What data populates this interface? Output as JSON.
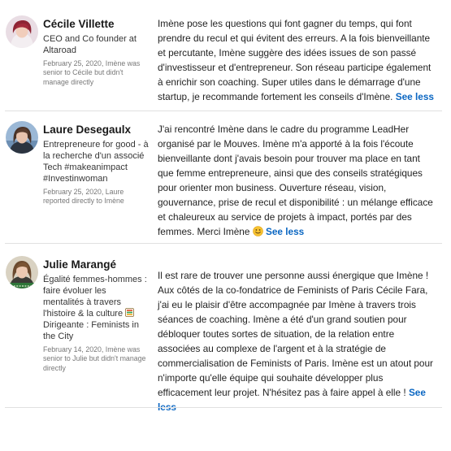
{
  "recommendations": [
    {
      "name": "Cécile Villette",
      "headline": "CEO and Co founder at Altaroad",
      "meta": "February 25, 2020, Imène was senior to Cécile but didn't manage directly",
      "text": "Imène pose les questions qui font gagner du temps, qui font prendre du recul et qui évitent des erreurs. A la fois bienveillante et percutante, Imène suggère des idées issues de son passé d'investisseur et d'entrepreneur. Son réseau participe également à enrichir son coaching. Super utiles dans le démarrage d'une startup, je recommande fortement les conseils d'Imène.",
      "see_less": "See less"
    },
    {
      "name": "Laure Desegaulx",
      "headline": "Entrepreneure for good - à la recherche d'un associé Tech #makeanimpact #Investinwoman",
      "meta": "February 25, 2020, Laure reported directly to Imène",
      "text": "J'ai rencontré Imène dans le cadre du programme LeadHer organisé par le Mouves. Imène m'a apporté à la fois l'écoute bienveillante dont j'avais besoin pour trouver ma place en tant que femme entrepreneure, ainsi que des conseils stratégiques pour orienter mon business. Ouverture réseau, vision, gouvernance, prise de recul et disponibilité : un mélange efficace et chaleureux au service de projets à impact, portés par des femmes. Merci Imène",
      "emoji": "smiling-face-icon",
      "see_less": "See less"
    },
    {
      "name": "Julie Marangé",
      "headline_1": "Égalité femmes-hommes : faire évoluer les mentalités à travers l'histoire & la culture",
      "headline_icon": "grid-badge-icon",
      "headline_2": "Dirigeante : Feminists in the City",
      "meta": "February 14, 2020, Imène was senior to Julie but didn't manage directly",
      "text": "Il est rare de trouver une personne aussi énergique que Imène ! Aux côtés de la co-fondatrice de Feminists of Paris Cécile Fara, j'ai eu le plaisir d'être accompagnée par Imène à travers trois séances de coaching. Imène a été d'un grand soutien pour débloquer toutes sortes de situation, de la relation entre associées au complexe de l'argent et à la stratégie de commercialisation de Feminists of Paris. Imène est un atout pour n'importe qu'elle équipe qui souhaite développer plus efficacement leur projet. N'hésitez pas à faire appel à elle !",
      "see_less": "See less"
    }
  ],
  "colors": {
    "link": "#0a66c2",
    "divider": "#e0e0e0",
    "meta": "#8c8c8c"
  }
}
